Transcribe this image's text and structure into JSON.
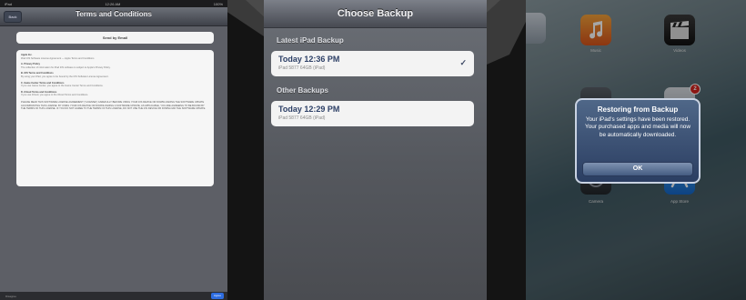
{
  "colors": {
    "background": "#141414",
    "link_blue": "#2c3f66",
    "agree_blue": "#2e6de0",
    "alert_blue": "#2b3e62"
  },
  "terms_panel": {
    "status_left": "iPad",
    "status_center": "12:26 AM",
    "status_right": "100%",
    "back_label": "Back",
    "title": "Terms and Conditions",
    "send_email_label": "Send by Email",
    "document": {
      "heading": "Apple Inc.",
      "intro": "iPad iOS Software License Agreement — Apple Terms and Conditions",
      "sections": [
        {
          "num": "A.",
          "title": "Privacy Policy",
          "body": "The collection of information for iPad iOS software is subject to Apple's Privacy Policy."
        },
        {
          "num": "B.",
          "title": "iOS Terms and Conditions",
          "body": "By using your iPad, you agree to be bound by the iOS Software License Agreement."
        },
        {
          "num": "C.",
          "title": "Game Center Terms and Conditions",
          "body": "If you use Game Center, you agree to the Game Center Terms and Conditions."
        },
        {
          "num": "D.",
          "title": "iCloud Terms and Conditions",
          "body": "If you use iCloud, you agree to the iCloud Terms and Conditions."
        }
      ],
      "notice": "PLEASE READ THIS SOFTWARE LICENSE AGREEMENT (\"LICENSE\") CAREFULLY BEFORE USING YOUR iOS DEVICE OR DOWNLOADING THE SOFTWARE UPDATE ACCOMPANYING THIS LICENSE. BY USING YOUR iOS DEVICE OR DOWNLOADING A SOFTWARE UPDATE, AS APPLICABLE, YOU ARE AGREEING TO BE BOUND BY THE TERMS OF THIS LICENSE. IF YOU DO NOT AGREE TO THE TERMS OF THIS LICENSE, DO NOT USE THE iOS DEVICE OR DOWNLOAD THE SOFTWARE UPDATE."
    },
    "bottom_left_label": "Disagree",
    "agree_label": "Agree"
  },
  "backup_panel": {
    "title": "Choose Backup",
    "latest_header": "Latest iPad Backup",
    "latest_item": {
      "time": "Today 12:36 PM",
      "detail": "iPad 5877 64GB (iPad)",
      "selected_mark": "✓"
    },
    "other_header": "Other Backups",
    "other_item": {
      "time": "Today 12:29 PM",
      "detail": "iPad 5877 64GB (iPad)"
    }
  },
  "restore_panel": {
    "apps": [
      {
        "name": "Music",
        "icon": "music-app-icon"
      },
      {
        "name": "Videos",
        "icon": "videos-app-icon"
      },
      {
        "name": "Camera",
        "icon": "camera-app-icon"
      },
      {
        "name": "App Store",
        "icon": "app-store-icon"
      }
    ],
    "badge_count": "2",
    "alert": {
      "title": "Restoring from Backup",
      "message": "Your iPad's settings have been restored. Your purchased apps and media will now be automatically downloaded.",
      "ok_label": "OK"
    }
  }
}
